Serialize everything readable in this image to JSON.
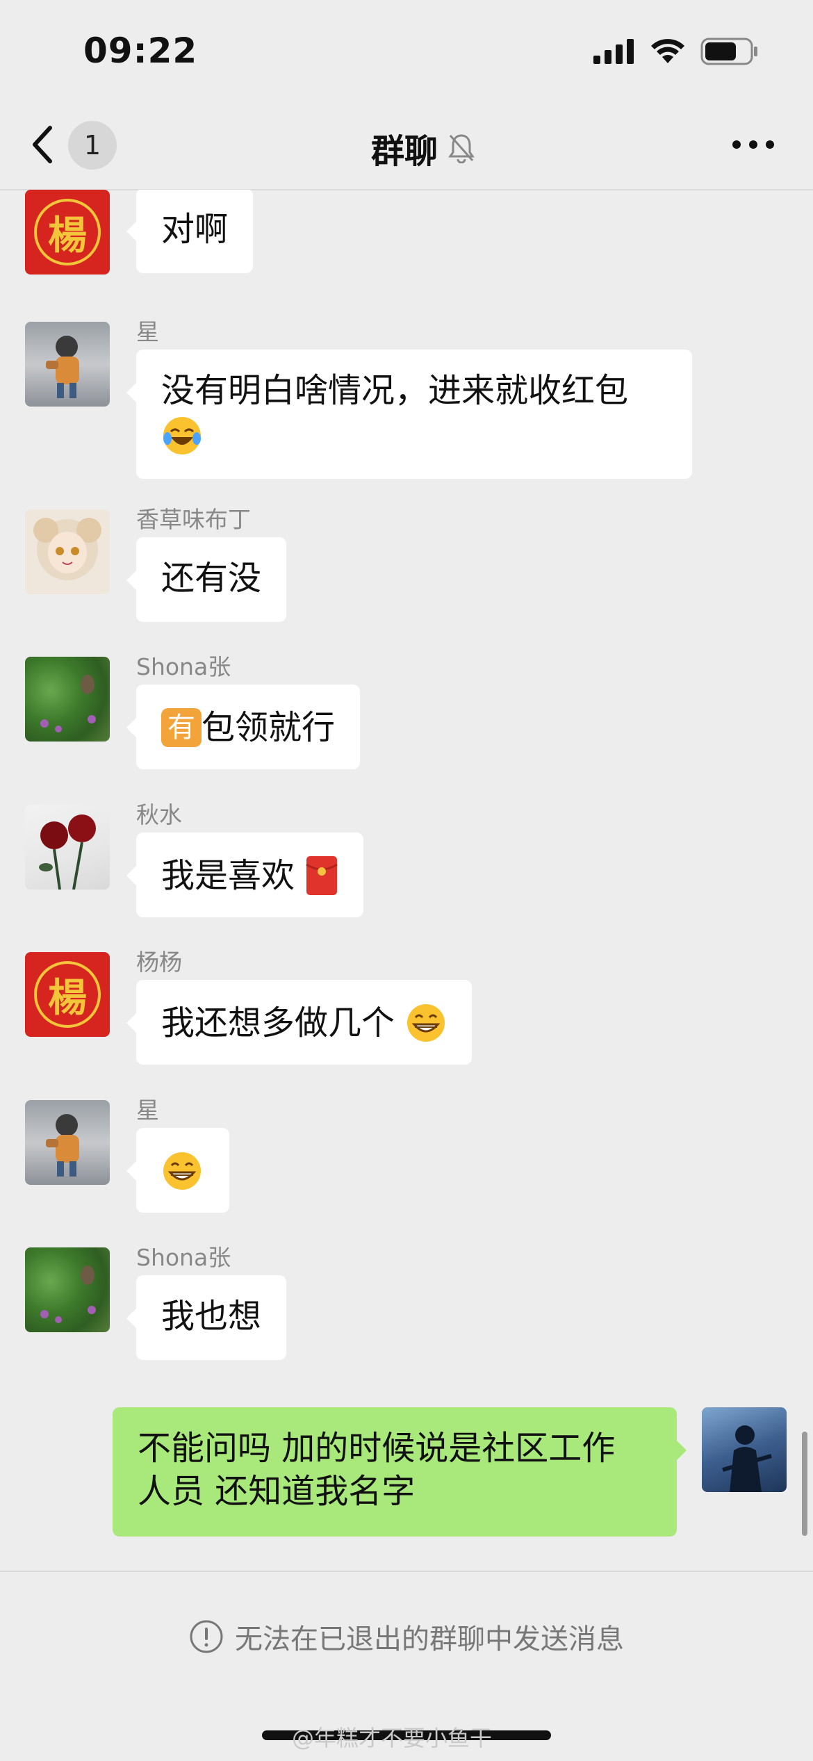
{
  "status_bar": {
    "time": "09:22"
  },
  "nav": {
    "unread_count": "1",
    "title": "群聊"
  },
  "messages": [
    {
      "sender": "杨杨",
      "text": "对啊"
    },
    {
      "sender": "星",
      "text_line1": "没有明白啥情况，进来就收红包"
    },
    {
      "sender": "香草味布丁",
      "text": "还有没"
    },
    {
      "sender": "Shona张",
      "badge": "有",
      "text": "包领就行"
    },
    {
      "sender": "秋水",
      "text": "我是喜欢"
    },
    {
      "sender": "杨杨",
      "text": "我还想多做几个"
    },
    {
      "sender": "星"
    },
    {
      "sender": "Shona张",
      "text": "我也想"
    },
    {
      "text_line1": "不能问吗 加的时候说是社区工作",
      "text_line2": "人员 还知道我名字"
    }
  ],
  "avatars": {
    "seal_char": "楊"
  },
  "bottom": {
    "notice": "无法在已退出的群聊中发送消息"
  },
  "watermark": "@年糕才不要小鱼干",
  "colors": {
    "background": "#ededed",
    "bubble_in": "#ffffff",
    "bubble_out": "#a9e97b",
    "seal_red": "#d6251f"
  },
  "icons": [
    "back-arrow-icon",
    "mute-bell-icon",
    "more-dots-icon",
    "signal-icon",
    "wifi-icon",
    "battery-icon",
    "laughing-tears-emoji",
    "red-envelope-emoji",
    "grinning-emoji",
    "info-icon"
  ]
}
